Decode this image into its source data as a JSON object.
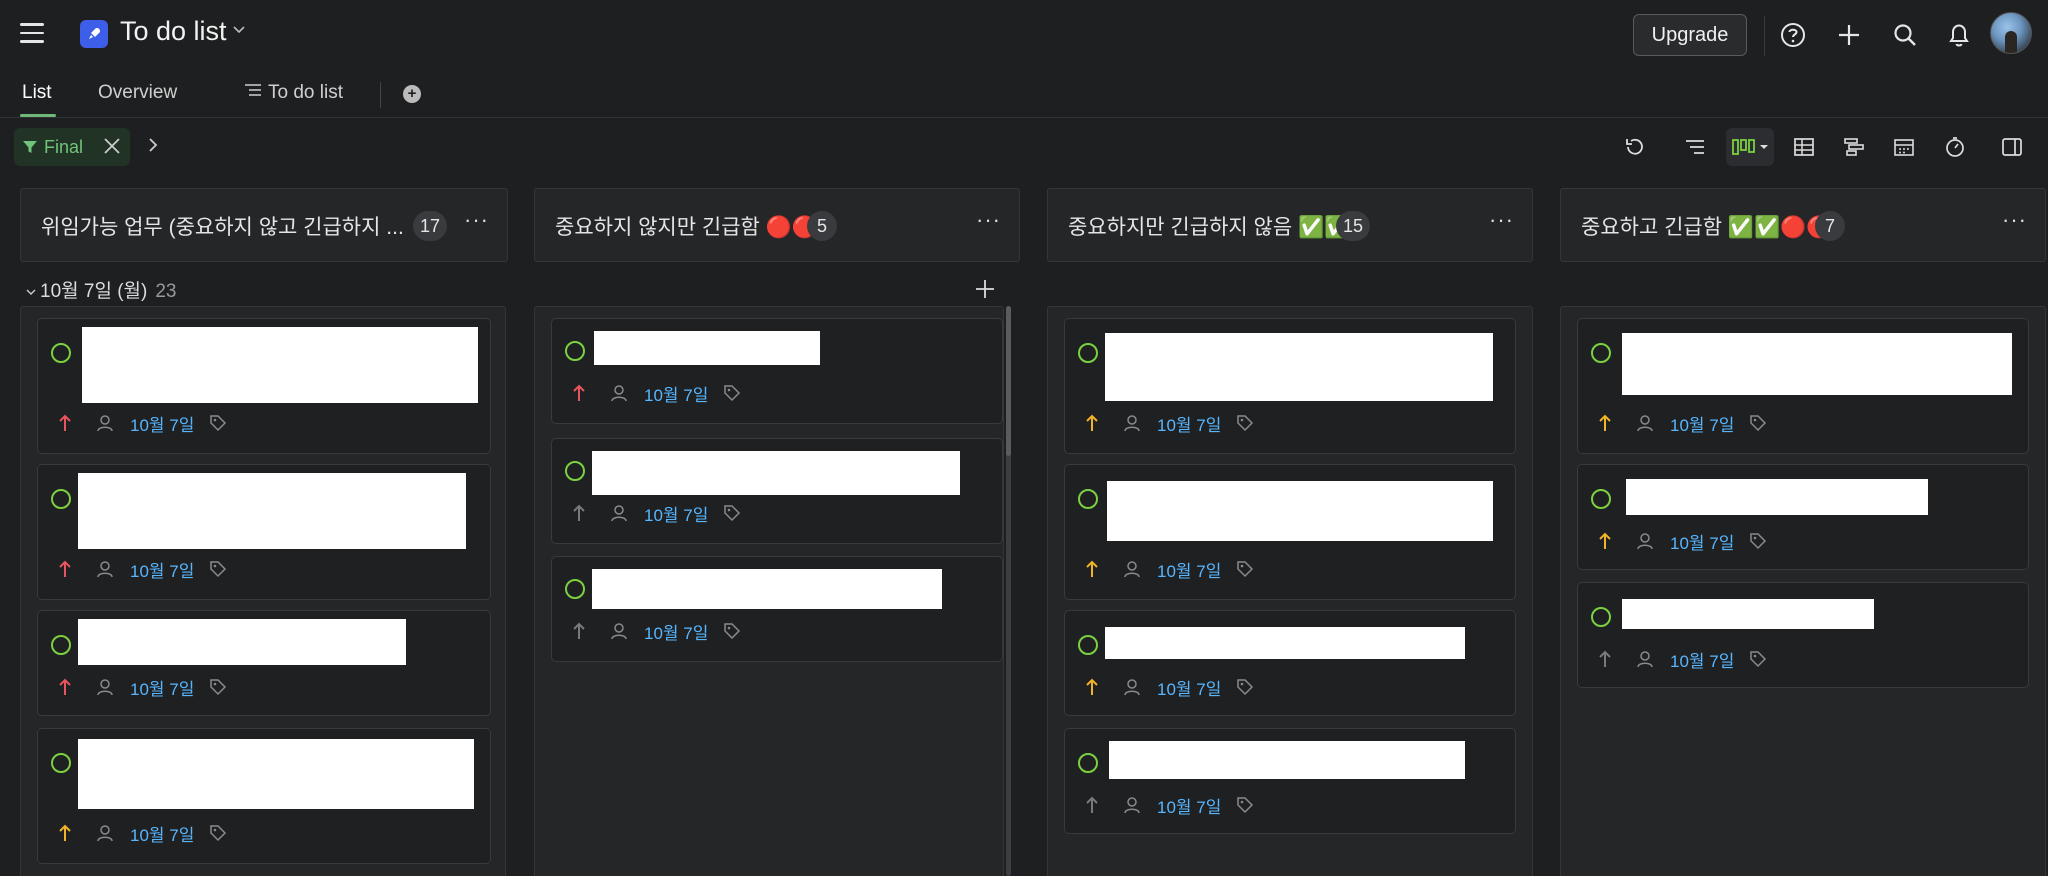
{
  "header": {
    "project_title": "To do list",
    "upgrade_label": "Upgrade"
  },
  "tabs": [
    {
      "label": "List"
    },
    {
      "label": "Overview"
    },
    {
      "label": "To do list"
    }
  ],
  "filter": {
    "label": "Final"
  },
  "group": {
    "label": "10월 7일 (월)",
    "count": "23"
  },
  "colors": {
    "accent_green": "#7bd13f",
    "date_blue": "#58b6ff",
    "priority_high": "#e8555f",
    "priority_medium": "#f0b429",
    "priority_low": "#7a7a7a"
  },
  "columns": [
    {
      "title": "위임가능 업무 (중요하지 않고 긴급하지 ...",
      "count": "17",
      "cards": [
        {
          "priority": "high",
          "date": "10월 7일"
        },
        {
          "priority": "high",
          "date": "10월 7일"
        },
        {
          "priority": "high",
          "date": "10월 7일"
        },
        {
          "priority": "medium",
          "date": "10월 7일"
        }
      ]
    },
    {
      "title": "중요하지 않지만 긴급함 🔴🔴",
      "count": "5",
      "cards": [
        {
          "priority": "high",
          "date": "10월 7일"
        },
        {
          "priority": "low",
          "date": "10월 7일"
        },
        {
          "priority": "low",
          "date": "10월 7일"
        }
      ]
    },
    {
      "title": "중요하지만 긴급하지 않음 ✅✅",
      "count": "15",
      "cards": [
        {
          "priority": "medium",
          "date": "10월 7일"
        },
        {
          "priority": "medium",
          "date": "10월 7일"
        },
        {
          "priority": "medium",
          "date": "10월 7일"
        },
        {
          "priority": "low",
          "date": "10월 7일"
        }
      ]
    },
    {
      "title": "중요하고 긴급함 ✅✅🔴🔴",
      "count": "7",
      "cards": [
        {
          "priority": "medium",
          "date": "10월 7일"
        },
        {
          "priority": "medium",
          "date": "10월 7일"
        },
        {
          "priority": "low",
          "date": "10월 7일"
        }
      ]
    }
  ]
}
